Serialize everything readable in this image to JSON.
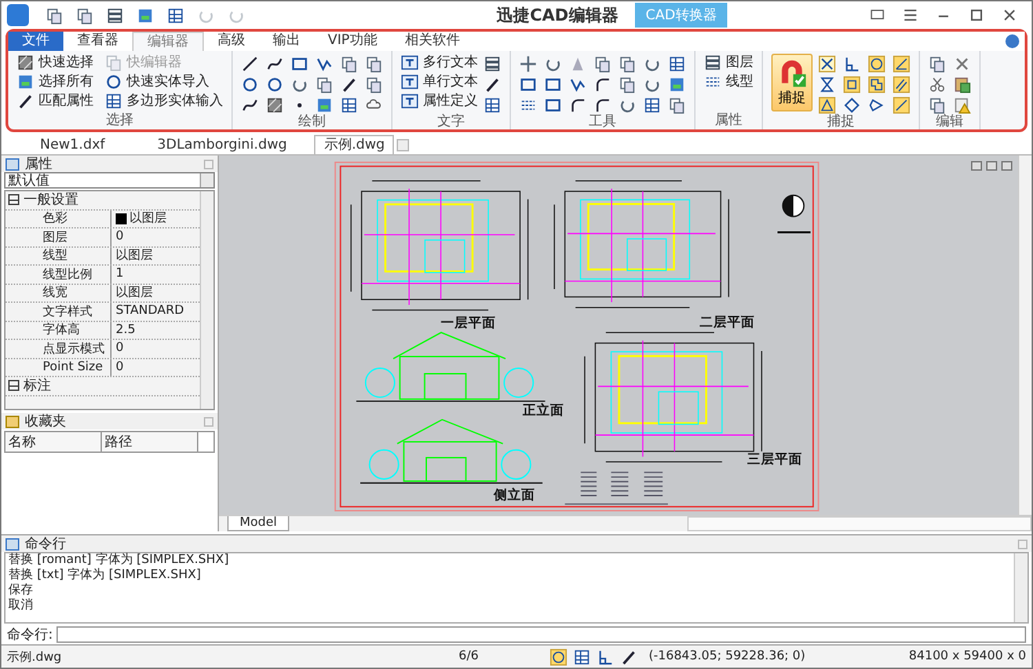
{
  "window": {
    "title": "迅捷CAD编辑器",
    "converter_button": "CAD转换器"
  },
  "ribbon": {
    "tabs": [
      {
        "label": "文件",
        "selected": false,
        "kind": "file"
      },
      {
        "label": "查看器",
        "selected": false,
        "kind": "tab"
      },
      {
        "label": "编辑器",
        "selected": true,
        "kind": "tab"
      },
      {
        "label": "高级",
        "selected": false,
        "kind": "tab"
      },
      {
        "label": "输出",
        "selected": false,
        "kind": "tab"
      },
      {
        "label": "VIP功能",
        "selected": false,
        "kind": "tab"
      },
      {
        "label": "相关软件",
        "selected": false,
        "kind": "tab"
      }
    ],
    "groups": [
      {
        "title": "选择",
        "kind": "select",
        "buttons": [
          {
            "label": "快速选择",
            "disabled": false
          },
          {
            "label": "快编辑器",
            "disabled": true
          },
          {
            "label": "选择所有",
            "disabled": false
          },
          {
            "label": "快速实体导入",
            "disabled": false
          },
          {
            "label": "匹配属性",
            "disabled": false
          },
          {
            "label": "多边形实体输入",
            "disabled": false
          }
        ]
      },
      {
        "title": "绘制",
        "kind": "draw"
      },
      {
        "title": "文字",
        "kind": "text",
        "buttons": [
          {
            "label": "多行文本",
            "disabled": false
          },
          {
            "label": "单行文本",
            "disabled": false
          },
          {
            "label": "属性定义",
            "disabled": false
          }
        ]
      },
      {
        "title": "工具",
        "kind": "tools"
      },
      {
        "title": "属性",
        "kind": "props",
        "buttons": [
          {
            "label": "图层",
            "disabled": false
          },
          {
            "label": "线型",
            "disabled": false
          }
        ]
      },
      {
        "title": "捕捉",
        "kind": "snap",
        "big_button": {
          "label": "捕捉",
          "on": true
        }
      },
      {
        "title": "编辑",
        "kind": "edit"
      }
    ]
  },
  "document_tabs": [
    {
      "label": "New1.dxf",
      "selected": false
    },
    {
      "label": "3DLamborgini.dwg",
      "selected": false
    },
    {
      "label": "示例.dwg",
      "selected": true
    }
  ],
  "properties": {
    "title": "属性",
    "dropdown": "默认值",
    "rows": [
      {
        "kind": "group",
        "name": "一般设置",
        "expanded": true
      },
      {
        "kind": "color",
        "name": "色彩",
        "value": "以图层",
        "color": "#000000"
      },
      {
        "kind": "item",
        "name": "图层",
        "value": "0"
      },
      {
        "kind": "item",
        "name": "线型",
        "value": "以图层"
      },
      {
        "kind": "item",
        "name": "线型比例",
        "value": "1"
      },
      {
        "kind": "item",
        "name": "线宽",
        "value": "以图层"
      },
      {
        "kind": "item",
        "name": "文字样式",
        "value": "STANDARD"
      },
      {
        "kind": "item",
        "name": "字体高",
        "value": "2.5"
      },
      {
        "kind": "item",
        "name": "点显示模式",
        "value": "0"
      },
      {
        "kind": "item",
        "name": "Point Size",
        "value": "0"
      },
      {
        "kind": "group",
        "name": "标注",
        "expanded": true
      }
    ]
  },
  "favorites": {
    "title": "收藏夹",
    "columns": [
      "名称",
      "路径"
    ]
  },
  "drawing": {
    "titles": [
      "一层平面",
      "二层平面",
      "正立面",
      "侧立面",
      "三层平面"
    ],
    "layout_tab": "Model"
  },
  "command_line": {
    "title": "命令行",
    "lines": [
      "替换 [romant] 字体为 [SIMPLEX.SHX]",
      "替换 [txt] 字体为 [SIMPLEX.SHX]",
      "保存",
      "取消"
    ],
    "prompt": "命令行:"
  },
  "status_bar": {
    "file": "示例.dwg",
    "pages": "6/6",
    "coordinates": "(-16843.05; 59228.36; 0)",
    "size": "84100 x 59400 x 0"
  }
}
